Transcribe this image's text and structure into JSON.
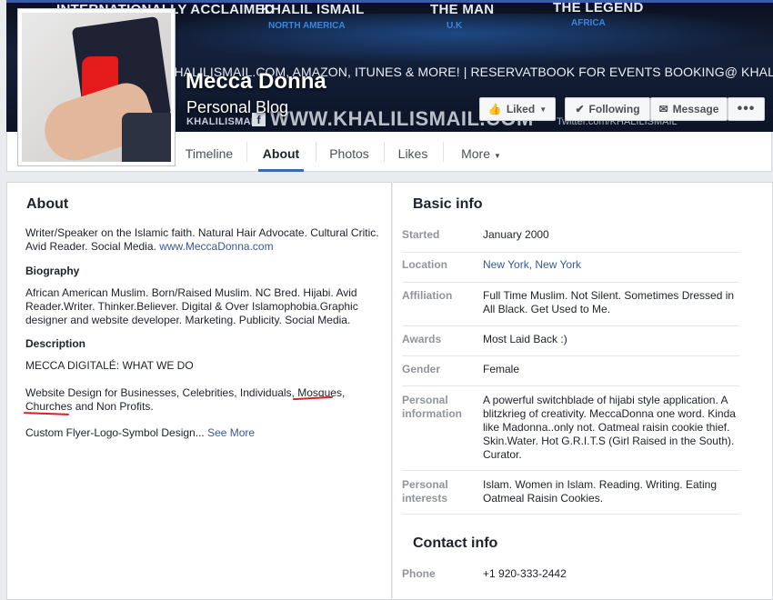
{
  "cover": {
    "banner_top": [
      {
        "text": "INTERNATIONALLY ACCLAIMED",
        "sub": "ED"
      },
      {
        "text": "KHALIL ISMAIL",
        "sub": "NORTH AMERICA"
      },
      {
        "text": "THE MAN",
        "sub": "U.K"
      },
      {
        "text": "THE LEGEND",
        "sub": "AFRICA"
      }
    ],
    "banner_strip": "KHALILISMAIL.COM, AMAZON, ITUNES & MORE! | RESERVATBOOK FOR EVENTS BOOKING@ KHALILISMAIL.COM",
    "banner_handle": "KHALILISMAIL",
    "banner_url": "WWW.KHALILISMAIL.COM",
    "banner_twitter": "Twitter.com/KHALILISMAIL",
    "page_name": "Mecca Donna",
    "page_category": "Personal Blog"
  },
  "actions": {
    "liked": "Liked",
    "following": "Following",
    "message": "Message",
    "more": "•••"
  },
  "nav": {
    "timeline": "Timeline",
    "about": "About",
    "photos": "Photos",
    "likes": "Likes",
    "more": "More"
  },
  "about": {
    "heading": "About",
    "intro": "Writer/Speaker on the Islamic faith. Natural Hair Advocate. Cultural Critic. Avid Reader. Social Media.",
    "intro_link": "www.MeccaDonna.com",
    "biography_heading": "Biography",
    "biography": "African American Muslim. Born/Raised Muslim. NC Bred. Hijabi. Avid Reader.Writer. Thinker.Believer. Digital & Over Islamophobia.Graphic designer and website developer. Marketing. Publicity. Social Media.",
    "description_heading": "Description",
    "desc_line1": "MECCA DIGITALÉ: WHAT WE DO",
    "desc_line2": "Website Design for Businesses, Celebrities, Individuals, Mosques, Churches and Non Profits.",
    "desc_line3": "Custom Flyer-Logo-Symbol Design...",
    "see_more": "See More"
  },
  "basic_info": {
    "heading": "Basic info",
    "rows": [
      {
        "label": "Started",
        "value": "January 2000"
      },
      {
        "label": "Location",
        "value": "New York, New York"
      },
      {
        "label": "Affiliation",
        "value": "Full Time Muslim. Not Silent. Sometimes Dressed in All Black. Get Used to Me."
      },
      {
        "label": "Awards",
        "value": "Most Laid Back :)"
      },
      {
        "label": "Gender",
        "value": "Female"
      },
      {
        "label": "Personal information",
        "value": "A powerful switchblade of hijabi style application. A blitzkrieg of creativity. MeccaDonna one word. Kinda like Madonna..only not. Oatmeal raisin cookie thief. Skin.Water. Hot G.R.I.T.S (Girl Raised in the South). Curator."
      },
      {
        "label": "Personal interests",
        "value": "Islam. Women in Islam. Reading. Writing. Eating Oatmeal Raisin Cookies."
      }
    ]
  },
  "contact_info": {
    "heading": "Contact info",
    "phone_label": "Phone",
    "phone_value": "+1 920-333-2442"
  },
  "colors": {
    "link": "#365899",
    "accent": "#4267b2",
    "annotation_red": "#d42222"
  }
}
